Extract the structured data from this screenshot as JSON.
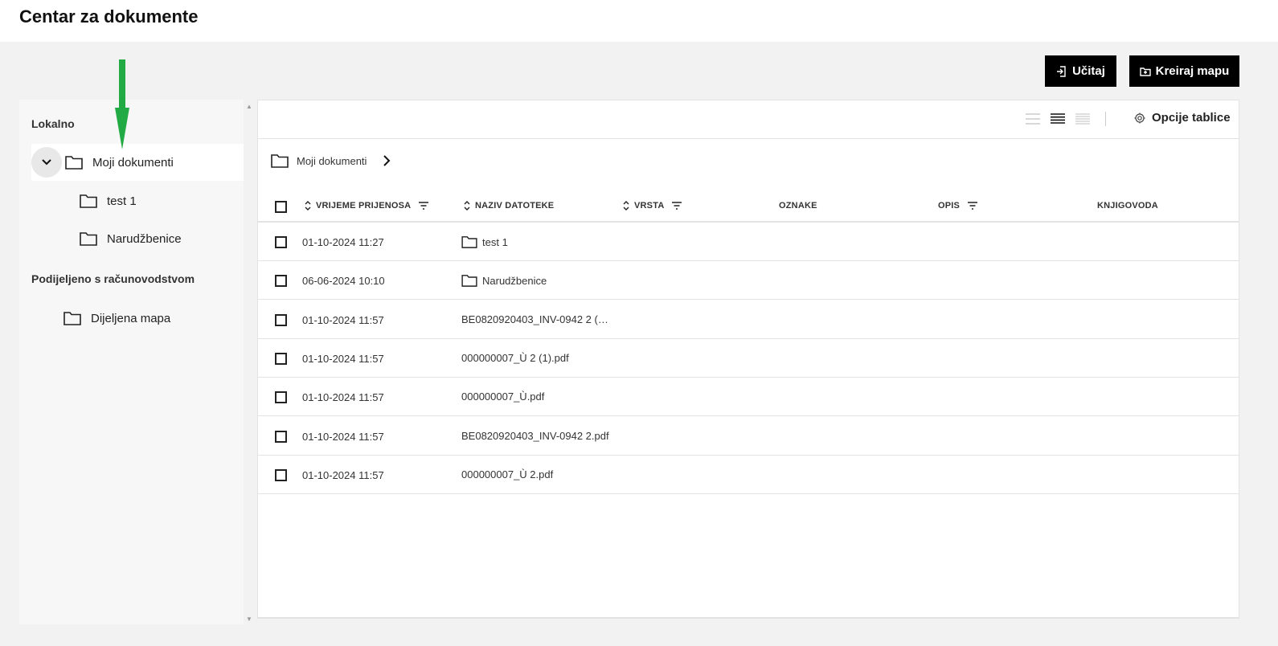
{
  "header": {
    "title": "Centar za dokumente"
  },
  "actions": {
    "upload_label": "Učitaj",
    "create_folder_label": "Kreiraj mapu"
  },
  "sidebar": {
    "local_label": "Lokalno",
    "my_documents": "Moji dokumenti",
    "children": [
      "test 1",
      "Narudžbenice"
    ],
    "shared_label": "Podijeljeno s računovodstvom",
    "shared_folder": "Dijeljena mapa"
  },
  "toolbar": {
    "table_options_label": "Opcije tablice"
  },
  "breadcrumb": {
    "current": "Moji dokumenti"
  },
  "table": {
    "columns": {
      "upload_time": "VRIJEME PRIJENOSA",
      "file_name": "NAZIV DATOTEKE",
      "type": "VRSTA",
      "tags": "OZNAKE",
      "description": "OPIS",
      "bookkeeper": "KNJIGOVODA"
    },
    "rows": [
      {
        "time": "01-10-2024 11:27",
        "name": "test 1",
        "folder": true
      },
      {
        "time": "06-06-2024 10:10",
        "name": "Narudžbenice",
        "folder": true
      },
      {
        "time": "01-10-2024 11:57",
        "name": "BE0820920403_INV-0942 2 (…",
        "folder": false
      },
      {
        "time": "01-10-2024 11:57",
        "name": "000000007_Ù 2 (1).pdf",
        "folder": false
      },
      {
        "time": "01-10-2024 11:57",
        "name": "000000007_Ù.pdf",
        "folder": false
      },
      {
        "time": "01-10-2024 11:57",
        "name": "BE0820920403_INV-0942 2.pdf",
        "folder": false
      },
      {
        "time": "01-10-2024 11:57",
        "name": "000000007_Ù 2.pdf",
        "folder": false
      }
    ]
  },
  "colors": {
    "accent_arrow": "#22aa44",
    "button_bg": "#000000"
  },
  "icons": [
    "folder-icon",
    "chevron-down-icon",
    "chevron-right-icon",
    "sort-icon",
    "filter-icon",
    "gear-icon",
    "upload-icon",
    "create-folder-icon",
    "view-compact-icon",
    "view-normal-icon",
    "view-comfortable-icon"
  ]
}
